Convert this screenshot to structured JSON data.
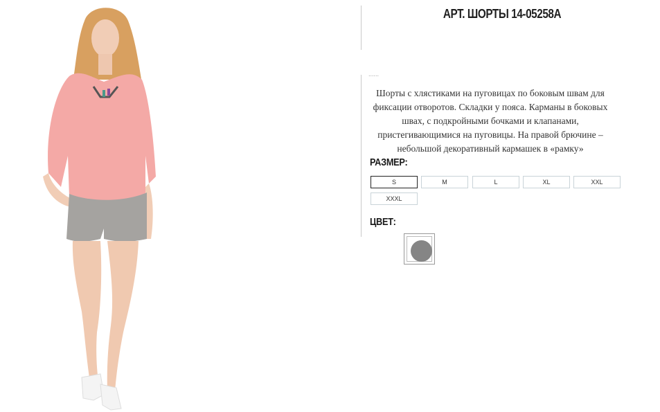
{
  "product": {
    "title": "АРТ. ШОРТЫ 14-05258А",
    "dots": "......",
    "description": "Шорты с хлястиками на пуговицах по боковым швам для фиксации отворотов. Складки у пояса. Карманы в боковых швах, с подкройными бочками и клапанами, пристегивающимися на пуговицы. На правой брючине – небольшой декоративный кармашек в «рамку»"
  },
  "size": {
    "label": "РАЗМЕР:",
    "options": [
      "S",
      "M",
      "L",
      "XL",
      "XXL",
      "XXXL"
    ],
    "selected": "S"
  },
  "color": {
    "label": "ЦВЕТ:",
    "swatches": [
      {
        "hex": "#858585"
      }
    ]
  },
  "photo": {
    "icon": "model-photo"
  }
}
